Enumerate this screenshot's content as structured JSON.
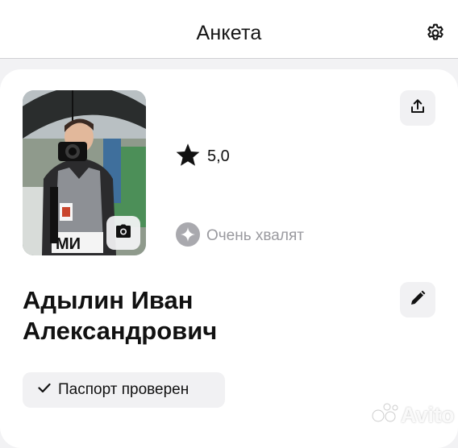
{
  "header": {
    "title": "Анкета",
    "settings_icon": "gear-icon"
  },
  "profile": {
    "photo_press_badge": "МИ",
    "camera_icon": "camera-icon",
    "share_icon": "share-icon",
    "rating": {
      "icon": "star-icon",
      "value": "5,0"
    },
    "praise": {
      "icon": "sparkle-icon",
      "text": "Очень хвалят"
    },
    "name_line1": "Адылин Иван",
    "name_line2": "Александрович",
    "edit_icon": "pencil-icon",
    "passport": {
      "icon": "check-icon",
      "label": "Паспорт проверен"
    }
  },
  "watermark": {
    "text": "Avito"
  },
  "colors": {
    "background": "#f2f2f4",
    "card": "#ffffff",
    "button_bg": "#f1f1f3",
    "muted_text": "#9a9a9f",
    "text": "#111111"
  }
}
